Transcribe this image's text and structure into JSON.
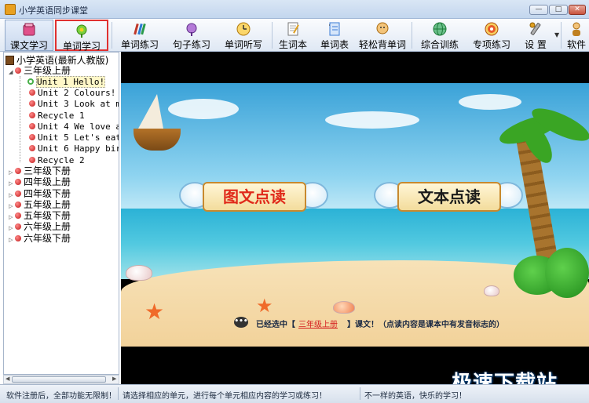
{
  "window": {
    "title": "小学英语同步课堂",
    "min_label": "—",
    "max_label": "□",
    "close_label": "✕"
  },
  "toolbar": {
    "items": [
      {
        "label": "课文学习",
        "icon": "book-pink-icon",
        "color": "#e0508a"
      },
      {
        "label": "单词学习",
        "icon": "flower-icon",
        "color": "#5ab82c"
      },
      {
        "label": "单词练习",
        "icon": "pencils-icon",
        "color": "#c0392b"
      },
      {
        "label": "句子练习",
        "icon": "microphone-icon",
        "color": "#8e44ad"
      },
      {
        "label": "单词听写",
        "icon": "clock-icon",
        "color": "#f0a020"
      },
      {
        "label": "生词本",
        "icon": "notepad-icon",
        "color": "#888888"
      },
      {
        "label": "单词表",
        "icon": "notebook-icon",
        "color": "#3a7bd5"
      },
      {
        "label": "轻松背单词",
        "icon": "head-icon",
        "color": "#e07a20"
      },
      {
        "label": "综合训练",
        "icon": "globe-icon",
        "color": "#2a9a4a"
      },
      {
        "label": "专项练习",
        "icon": "target-icon",
        "color": "#d04020"
      },
      {
        "label": "设 置",
        "icon": "wrench-icon",
        "color": "#777777"
      },
      {
        "label": "软件",
        "icon": "person-icon",
        "color": "#c08020"
      }
    ]
  },
  "tree": {
    "root": "小学英语(最新人教版)",
    "grades": [
      {
        "label": "三年级上册",
        "expanded": true
      },
      {
        "label": "三年级下册"
      },
      {
        "label": "四年级上册"
      },
      {
        "label": "四年级下册"
      },
      {
        "label": "五年级上册"
      },
      {
        "label": "五年级下册"
      },
      {
        "label": "六年级上册"
      },
      {
        "label": "六年级下册"
      }
    ],
    "units": [
      "Unit 1 Hello!",
      "Unit 2 Colours!",
      "Unit 3 Look at m",
      "Recycle 1",
      "Unit 4 We love a",
      "Unit 5 Let's eat",
      "Unit 6 Happy bir",
      "Recycle 2"
    ],
    "selected_unit_index": 0
  },
  "main": {
    "button_1": "图文点读",
    "button_2": "文本点读",
    "hint": {
      "prefix": "已经选中【",
      "selected": "三年级上册",
      "suffix": "】课文！（点读内容是课本中有发音标志的）"
    }
  },
  "watermark": "极速下载站",
  "status": {
    "left": "软件注册后，全部功能无限制！",
    "middle": "请选择相应的单元，进行每个单元相应内容的学习或练习！",
    "right": "不一样的英语，快乐的学习！"
  }
}
